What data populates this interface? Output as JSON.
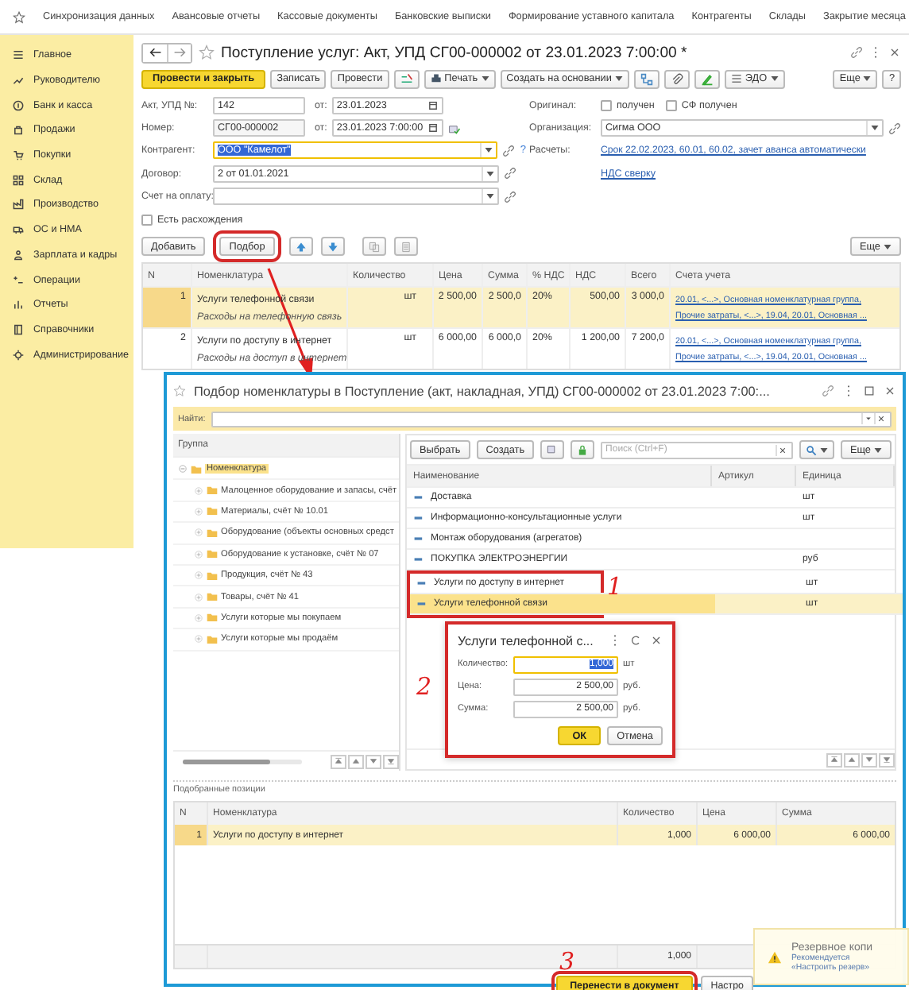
{
  "top_links": [
    "Синхронизация данных",
    "Авансовые отчеты",
    "Кассовые документы",
    "Банковские выписки",
    "Формирование уставного капитала",
    "Контрагенты",
    "Склады",
    "Закрытие месяца"
  ],
  "sidebar": {
    "items": [
      "Главное",
      "Руководителю",
      "Банк и касса",
      "Продажи",
      "Покупки",
      "Склад",
      "Производство",
      "ОС и НМА",
      "Зарплата и кадры",
      "Операции",
      "Отчеты",
      "Справочники",
      "Администрирование"
    ]
  },
  "document": {
    "title": "Поступление услуг: Акт, УПД СГ00-000002 от 23.01.2023 7:00:00 *",
    "toolbar": {
      "post_close": "Провести и закрыть",
      "save": "Записать",
      "post": "Провести",
      "print": "Печать",
      "create_based": "Создать на основании",
      "edo": "ЭДО",
      "more": "Еще",
      "help": "?"
    },
    "act": {
      "label": "Акт, УПД №:",
      "value": "142",
      "date_label": "от:",
      "date": "23.01.2023"
    },
    "number": {
      "label": "Номер:",
      "value": "СГ00-000002",
      "date_label": "от:",
      "date": "23.01.2023  7:00:00"
    },
    "counterparty": {
      "label": "Контрагент:",
      "value": "ООО \"Камелот\"",
      "help": "?"
    },
    "contract": {
      "label": "Договор:",
      "value": "2 от 01.01.2021"
    },
    "invoice": {
      "label": "Счет на оплату:"
    },
    "discrepancy": {
      "label": "Есть расхождения",
      "checked": false
    },
    "original": {
      "label": "Оригинал:",
      "options": [
        {
          "label": "получен",
          "checked": false
        },
        {
          "label": "СФ получен",
          "checked": false
        }
      ]
    },
    "organization": {
      "label": "Организация:",
      "value": "Сигма ООО"
    },
    "settlements": {
      "label": "Расчеты:",
      "link": "Срок 22.02.2023, 60.01, 60.02, зачет аванса автоматически"
    },
    "vat_link": "НДС сверку",
    "table_buttons": {
      "add": "Добавить",
      "pick": "Подбор",
      "more": "Еще"
    },
    "table": {
      "columns": [
        "N",
        "Номенклатура",
        "Количество",
        "Цена",
        "Сумма",
        "% НДС",
        "НДС",
        "Всего",
        "Счета учета"
      ],
      "rows": [
        {
          "n": "1",
          "name": "Услуги телефонной связи",
          "note": "Расходы на телефонную связь",
          "unit": "шт",
          "price": "2 500,00",
          "sum": "2 500,0",
          "vat_rate": "20%",
          "vat": "500,00",
          "total": "3 000,0",
          "accounts": [
            "20.01, <...>, Основная номенклатурная группа,",
            "Прочие затраты, <...>, 19.04, 20.01, Основная ..."
          ],
          "selected": true
        },
        {
          "n": "2",
          "name": "Услуги по доступу в интернет",
          "note": "Расходы на доступ в интернет",
          "unit": "шт",
          "price": "6 000,00",
          "sum": "6 000,0",
          "vat_rate": "20%",
          "vat": "1 200,00",
          "total": "7 200,0",
          "accounts": [
            "20.01, <...>, Основная номенклатурная группа,",
            "Прочие затраты, <...>, 19.04, 20.01, Основная ..."
          ],
          "selected": false
        }
      ]
    }
  },
  "picker": {
    "title": "Подбор номенклатуры в Поступление (акт, накладная, УПД) СГ00-000002 от 23.01.2023 7:00:...",
    "find_label": "Найти:",
    "group_header": "Группа",
    "tree": [
      {
        "label": "Номенклатура",
        "expanded": true,
        "children": [
          {
            "label": "Малоценное оборудование и запасы, счёт",
            "expanded": false
          },
          {
            "label": "Материалы, счёт № 10.01",
            "expanded": false
          },
          {
            "label": "Оборудование (объекты основных средст",
            "expanded": false
          },
          {
            "label": "Оборудование к установке, счёт № 07",
            "expanded": false
          },
          {
            "label": "Продукция, счёт № 43",
            "expanded": false
          },
          {
            "label": "Товары, счёт № 41",
            "expanded": false
          },
          {
            "label": "Услуги которые мы покупаем",
            "expanded": false
          },
          {
            "label": "Услуги которые мы продаём",
            "expanded": false
          }
        ]
      }
    ],
    "toolbar": {
      "choose": "Выбрать",
      "create": "Создать",
      "search_placeholder": "Поиск (Ctrl+F)",
      "more": "Еще"
    },
    "columns": [
      "Наименование",
      "Артикул",
      "Единица"
    ],
    "items": [
      {
        "name": "Доставка",
        "unit": "шт",
        "selected": false
      },
      {
        "name": "Информационно-консультационные услуги",
        "unit": "шт",
        "selected": false
      },
      {
        "name": "Монтаж оборудования (агрегатов)",
        "selected": false
      },
      {
        "name": "ПОКУПКА ЭЛЕКТРОЭНЕРГИИ",
        "unit": "руб",
        "selected": false
      },
      {
        "name": "Услуги по доступу в интернет",
        "unit": "шт",
        "selected": false
      },
      {
        "name": "Услуги телефонной связи",
        "unit": "шт",
        "selected": true
      }
    ],
    "picked_label": "Подобранные позиции",
    "picked_columns": [
      "N",
      "Номенклатура",
      "Количество",
      "Цена",
      "Сумма"
    ],
    "picked_rows": [
      {
        "n": "1",
        "name": "Услуги по доступу в интернет",
        "qty": "1,000",
        "price": "6 000,00",
        "sum": "6 000,00",
        "selected": true
      }
    ],
    "picked_total_qty": "1,000",
    "transfer_button": "Перенести в документ",
    "settings_button": "Настро"
  },
  "quantity_dialog": {
    "title": "Услуги телефонной с...",
    "fields": [
      {
        "label": "Количество:",
        "value": "1,000",
        "unit": "шт",
        "focused": true
      },
      {
        "label": "Цена:",
        "value": "2 500,00",
        "unit": "руб.",
        "focused": false
      },
      {
        "label": "Сумма:",
        "value": "2 500,00",
        "unit": "руб.",
        "focused": false
      }
    ],
    "ok": "ОК",
    "cancel": "Отмена"
  },
  "notification": {
    "title": "Резервное копи",
    "lines": [
      "Рекомендуется",
      "«Настроить резерв»"
    ]
  },
  "annotation_marks": [
    "1",
    "2",
    "3"
  ]
}
